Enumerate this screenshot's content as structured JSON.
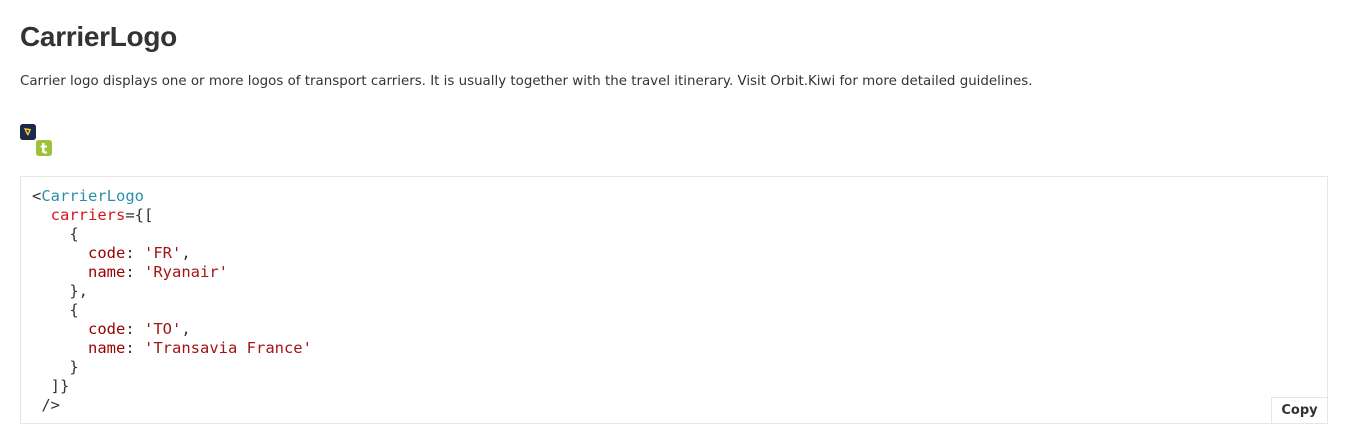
{
  "page": {
    "title": "CarrierLogo",
    "description": "Carrier logo displays one or more logos of transport carriers. It is usually together with the travel itinerary. Visit Orbit.Kiwi for more detailed guidelines."
  },
  "carrier_logos": [
    {
      "name": "ryanair-logo-icon",
      "color": "#1b2a4a"
    },
    {
      "name": "transavia-logo-icon",
      "color": "#9ec33a"
    }
  ],
  "code": {
    "component": "CarrierLogo",
    "prop": "carriers",
    "items": [
      {
        "code_key": "code",
        "code_value": "'FR'",
        "name_key": "name",
        "name_value": "'Ryanair'"
      },
      {
        "code_key": "code",
        "code_value": "'TO'",
        "name_key": "name",
        "name_value": "'Transavia France'"
      }
    ],
    "copy_label": "Copy"
  },
  "colors": {
    "tag": "#2a8fa8",
    "attribute": "#d4171e",
    "key": "#990000",
    "string": "#a31515"
  }
}
